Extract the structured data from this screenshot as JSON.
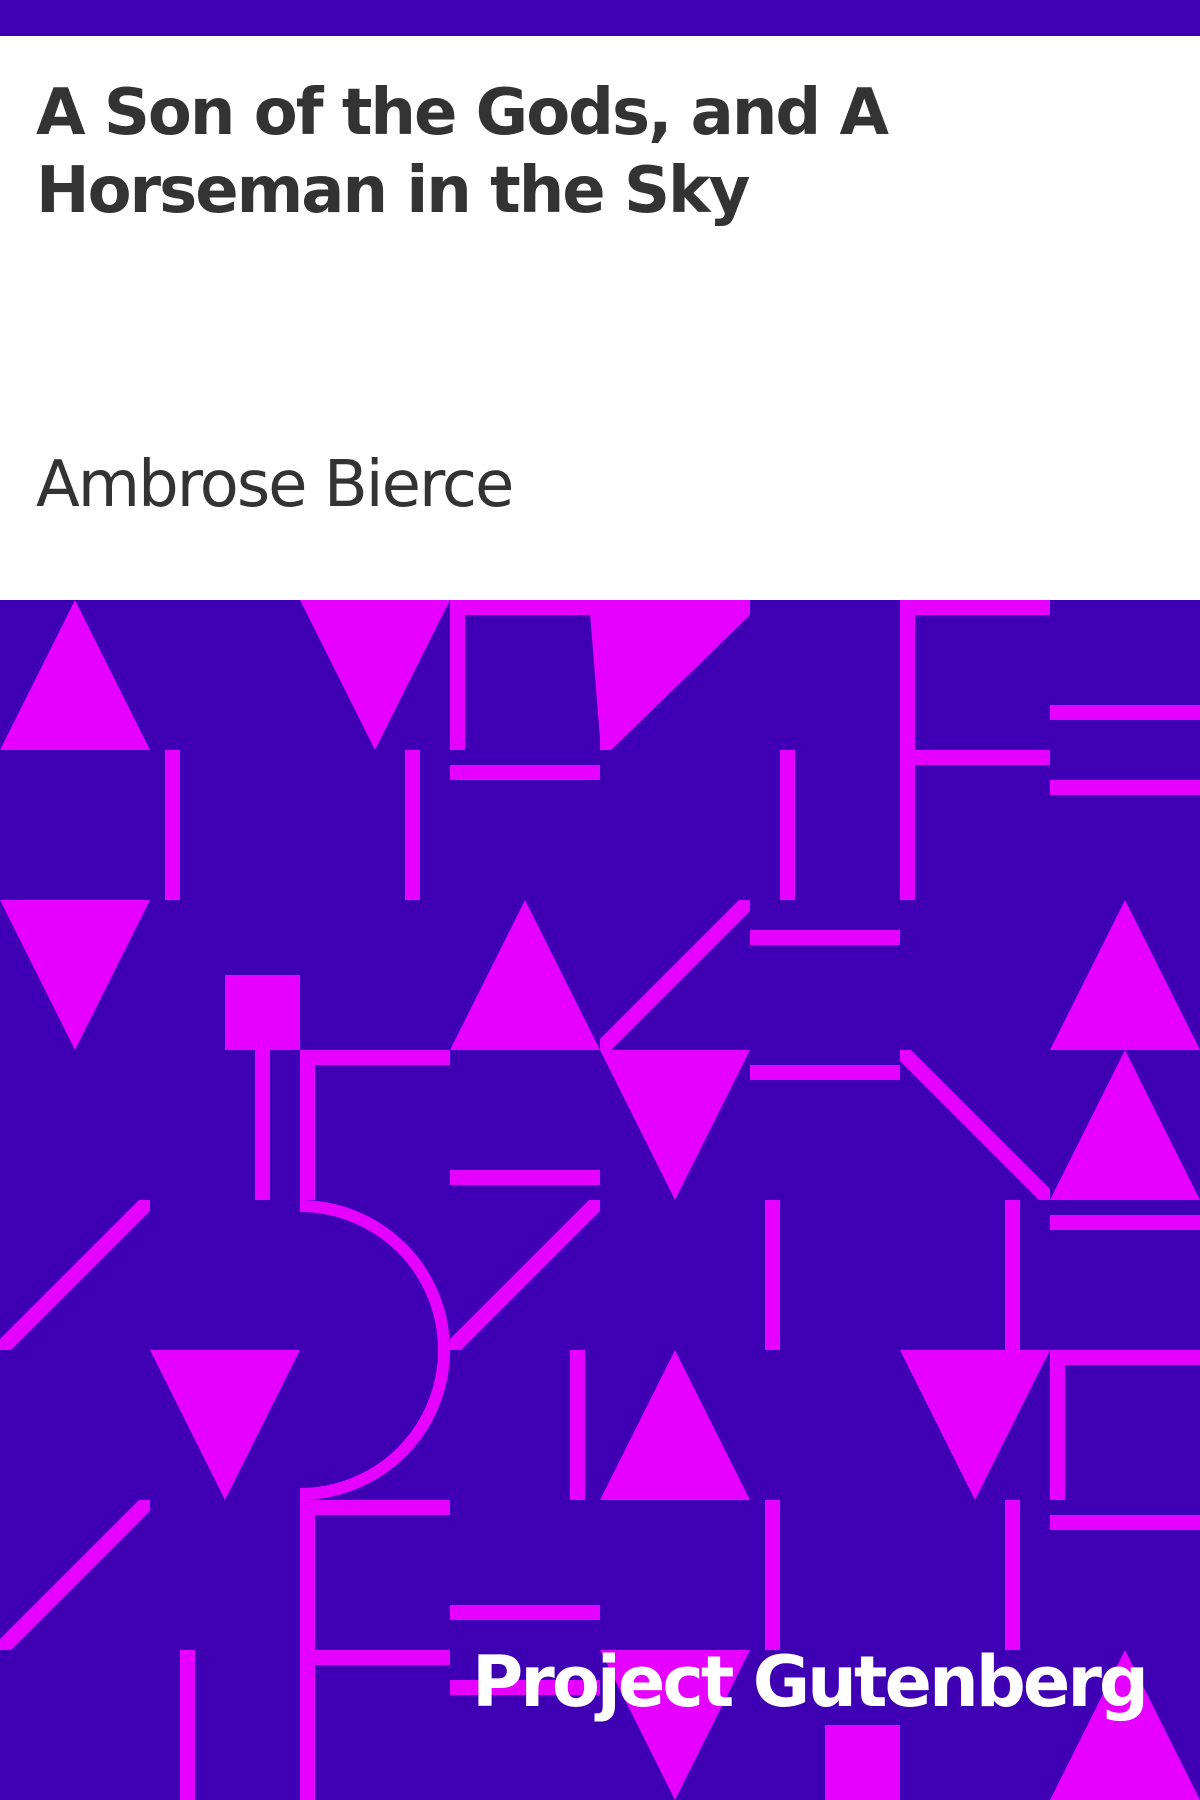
{
  "cover": {
    "title": "A Son of the Gods, and A Horseman in the Sky",
    "author": "Ambrose Bierce",
    "publisher": "Project Gutenberg"
  },
  "colors": {
    "background": "#3f00b4",
    "pattern": "#e600ff",
    "title_panel": "#ffffff",
    "text": "#333333",
    "publisher_text": "#ffffff"
  }
}
